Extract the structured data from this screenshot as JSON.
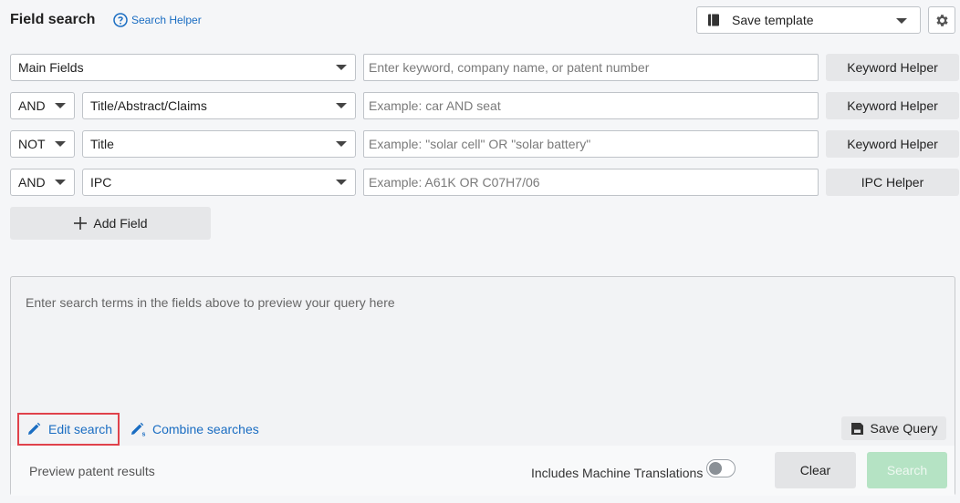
{
  "header": {
    "title": "Field search",
    "helper_link": "Search Helper",
    "template_select": "Save template",
    "icons": [
      "help-circle-icon",
      "book-icon",
      "gear-icon"
    ]
  },
  "fields": {
    "row1": {
      "field": "Main Fields",
      "placeholder": "Enter keyword, company name, or patent number",
      "helper": "Keyword Helper"
    },
    "row2": {
      "operator": "AND",
      "field": "Title/Abstract/Claims",
      "placeholder": "Example: car AND seat",
      "helper": "Keyword Helper"
    },
    "row3": {
      "operator": "NOT",
      "field": "Title",
      "placeholder": "Example: \"solar cell\" OR \"solar battery\"",
      "helper": "Keyword Helper"
    },
    "row4": {
      "operator": "AND",
      "field": "IPC",
      "placeholder": "Example: A61K OR C07H7/06",
      "helper": "IPC Helper"
    }
  },
  "add_field": "Add Field",
  "preview": {
    "placeholder": "Enter search terms in the fields above to preview your query here",
    "edit_search": "Edit search",
    "combine_searches": "Combine searches",
    "save_query": "Save Query"
  },
  "footer": {
    "preview_results": "Preview patent results",
    "machine_translations": "Includes Machine Translations",
    "machine_translations_on": false,
    "clear": "Clear",
    "search": "Search"
  },
  "colors": {
    "link": "#1a6dc2",
    "highlight_border": "#e0424b",
    "search_button_disabled": "#b5e3c4"
  }
}
